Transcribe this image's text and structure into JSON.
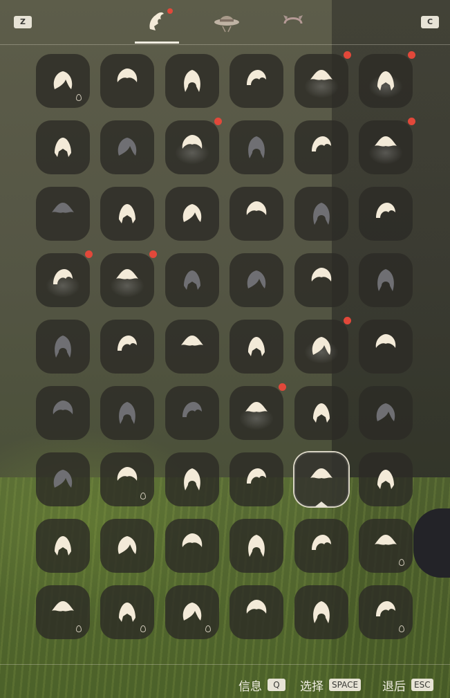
{
  "topbar": {
    "left_key": "Z",
    "right_key": "C",
    "tabs": [
      {
        "icon": "hair-icon",
        "active": true,
        "new": true
      },
      {
        "icon": "hat-icon",
        "active": false,
        "new": false
      },
      {
        "icon": "headband-icon",
        "active": false,
        "new": false
      }
    ]
  },
  "grid": {
    "rows": 9,
    "cols": 6,
    "selected": [
      6,
      4
    ],
    "new_badges": [
      [
        0,
        4
      ],
      [
        0,
        5
      ],
      [
        1,
        2
      ],
      [
        1,
        5
      ],
      [
        3,
        0
      ],
      [
        3,
        1
      ],
      [
        4,
        4
      ],
      [
        5,
        3
      ]
    ],
    "locked_dyeable": [
      [
        0,
        0
      ],
      [
        6,
        1
      ],
      [
        7,
        5
      ],
      [
        8,
        0
      ],
      [
        8,
        1
      ],
      [
        8,
        2
      ],
      [
        8,
        5
      ]
    ],
    "dimmed": [
      [
        1,
        1
      ],
      [
        1,
        3
      ],
      [
        2,
        0
      ],
      [
        2,
        4
      ],
      [
        3,
        2
      ],
      [
        3,
        3
      ],
      [
        3,
        5
      ],
      [
        4,
        0
      ],
      [
        5,
        0
      ],
      [
        5,
        1
      ],
      [
        5,
        2
      ],
      [
        5,
        5
      ],
      [
        6,
        0
      ]
    ]
  },
  "footer": {
    "info_label": "信息",
    "info_key": "Q",
    "select_label": "选择",
    "select_key": "SPACE",
    "back_label": "退后",
    "back_key": "ESC"
  },
  "colors": {
    "hair_light": "#f3ead8",
    "hair_dim": "#6f6f73",
    "badge": "#e2483a",
    "slot_bg": "#2c2b26"
  }
}
